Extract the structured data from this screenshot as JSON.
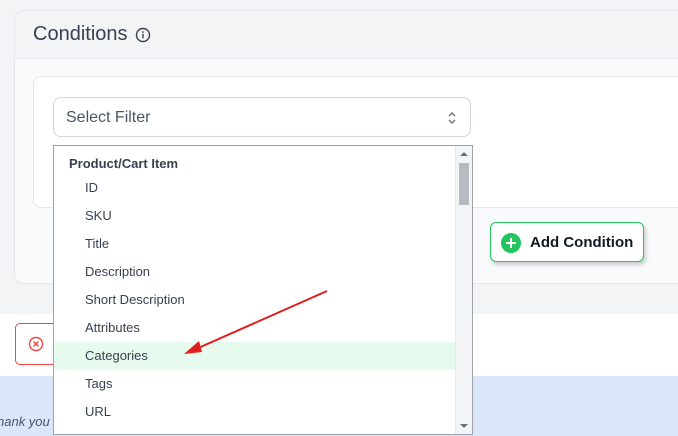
{
  "conditions": {
    "title": "Conditions",
    "info_icon": "info-circle-icon"
  },
  "filter_select": {
    "placeholder": "Select Filter",
    "icon": "chevron-updown-icon"
  },
  "add_condition": {
    "label": "Add Condition",
    "icon": "plus-circle-icon",
    "color": "#22c55e"
  },
  "remove_button": {
    "icon": "x-circle-icon",
    "color": "#ef4444"
  },
  "footer_text": "hank you",
  "dropdown": {
    "group": "Product/Cart Item",
    "options": [
      {
        "label": "ID"
      },
      {
        "label": "SKU"
      },
      {
        "label": "Title"
      },
      {
        "label": "Description"
      },
      {
        "label": "Short Description"
      },
      {
        "label": "Attributes"
      },
      {
        "label": "Categories",
        "highlighted": true
      },
      {
        "label": "Tags"
      },
      {
        "label": "URL"
      }
    ],
    "highlight_color": "#e7faee"
  },
  "annotation": {
    "arrow_color": "#e11d1d",
    "points_to": "Categories"
  }
}
